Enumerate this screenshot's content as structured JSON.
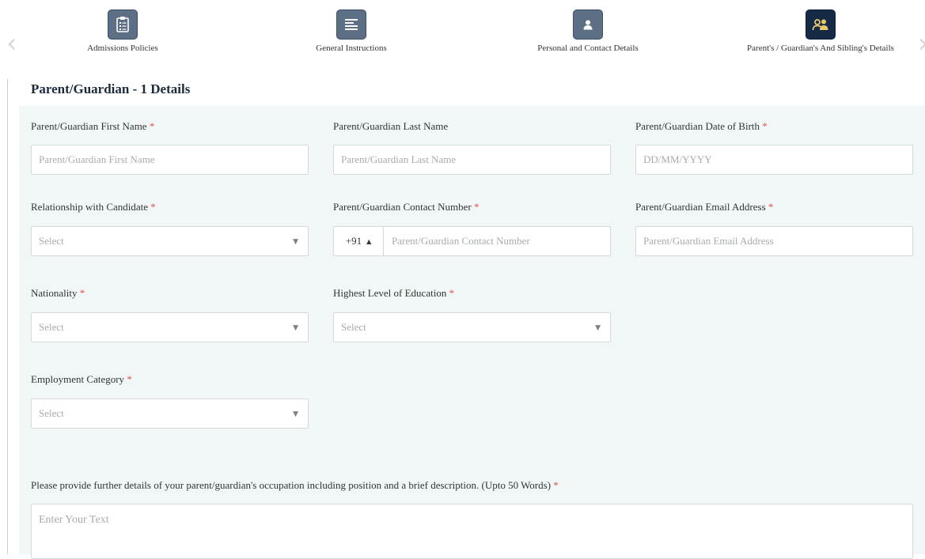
{
  "stepper": {
    "steps": [
      {
        "label": "Admissions Policies",
        "icon": "clipboard-list-icon"
      },
      {
        "label": "General Instructions",
        "icon": "text-lines-icon"
      },
      {
        "label": "Personal and Contact Details",
        "icon": "person-icon"
      },
      {
        "label": "Parent's / Guardian's And Sibling's Details",
        "icon": "group-users-icon",
        "active": true
      }
    ],
    "prev_arrow": "‹",
    "next_arrow": "›"
  },
  "section": {
    "title": "Parent/Guardian - 1 Details"
  },
  "form": {
    "required_mark": "*",
    "first_name": {
      "label": "Parent/Guardian First Name",
      "placeholder": "Parent/Guardian First Name",
      "value": ""
    },
    "last_name": {
      "label": "Parent/Guardian Last Name",
      "placeholder": "Parent/Guardian Last Name",
      "value": ""
    },
    "dob": {
      "label": "Parent/Guardian Date of Birth",
      "placeholder": "DD/MM/YYYY",
      "value": ""
    },
    "relationship": {
      "label": "Relationship with Candidate",
      "selected": "Select"
    },
    "contact": {
      "label": "Parent/Guardian Contact Number",
      "country_code": "+91",
      "placeholder": "Parent/Guardian Contact Number"
    },
    "email": {
      "label": "Parent/Guardian Email Address",
      "placeholder": "Parent/Guardian Email Address"
    },
    "nationality": {
      "label": "Nationality",
      "selected": "Select"
    },
    "education": {
      "label": "Highest Level of Education",
      "selected": "Select"
    },
    "employment": {
      "label": "Employment Category",
      "selected": "Select"
    },
    "occupation": {
      "label": "Please provide further details of your parent/guardian's occupation including position and a brief description. (Upto 50 Words)",
      "placeholder": "Enter Your Text"
    }
  },
  "colors": {
    "active_step": "#142a45",
    "inactive_step": "#5d6f84",
    "panel_bg": "#f1f7f7",
    "required": "#e0524f"
  }
}
